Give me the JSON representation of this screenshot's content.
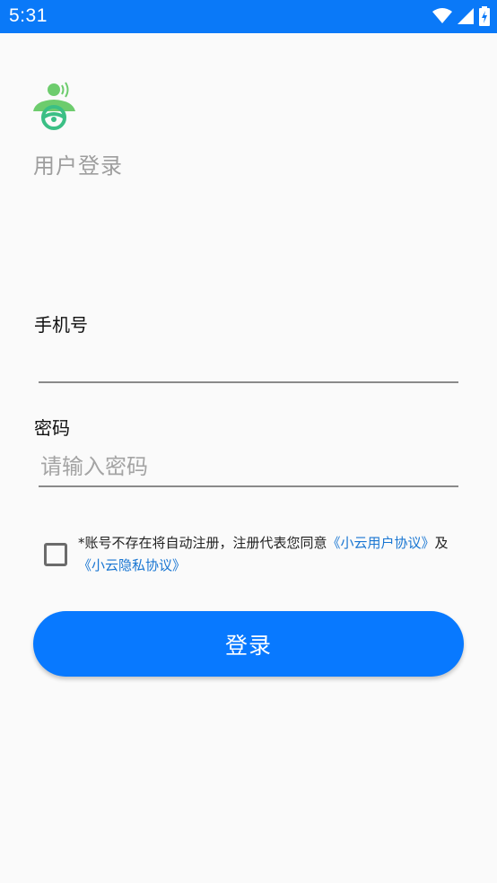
{
  "status_bar": {
    "time": "5:31",
    "icons": [
      "wifi-icon",
      "signal-icon",
      "battery-charging-icon"
    ],
    "background": "#0a79f8"
  },
  "header": {
    "logo": "driver-avatar-logo",
    "title": "用户登录"
  },
  "form": {
    "phone_label": "手机号",
    "phone_value": "",
    "phone_placeholder": "",
    "password_label": "密码",
    "password_value": "",
    "password_placeholder": "请输入密码"
  },
  "agreement": {
    "checked": false,
    "text_prefix": "*账号不存在将自动注册，注册代表您同意",
    "user_agreement_link": "《小云用户协议》",
    "conjunction": "及",
    "privacy_link": "《小云隐私协议》",
    "link_color": "#1976d2"
  },
  "login_button": {
    "label": "登录",
    "color": "#0879ff"
  }
}
